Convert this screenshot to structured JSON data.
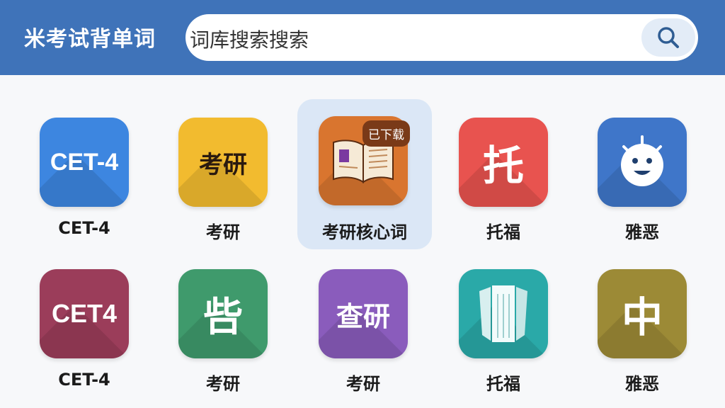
{
  "header": {
    "title": "米考试背单词",
    "search_value": "词库搜索搜索",
    "search_icon": "search-icon"
  },
  "colors": {
    "header_bg": "#3f73b9",
    "selected_bg": "#dbe7f6",
    "badge_bg": "#7a3a18"
  },
  "grid": {
    "row1": [
      {
        "label": "CET-4",
        "icon_text": "CET-4",
        "icon": "cet4-icon",
        "color": "#3d86e0"
      },
      {
        "label": "考研",
        "icon_text": "考研",
        "icon": "kaoyan-icon",
        "color": "#f2bb2f"
      },
      {
        "label": "考研核心词",
        "icon": "open-book-icon",
        "color": "#d9752f",
        "selected": true,
        "badge": "已下载"
      },
      {
        "label": "托福",
        "icon_text": "托",
        "icon": "toefl-icon",
        "color": "#e8534f"
      },
      {
        "label": "雅恶",
        "icon": "smiley-face-icon",
        "color": "#3f76c9"
      }
    ],
    "row2": [
      {
        "label": "CET-4",
        "icon_text": "CET4",
        "icon": "cet4-icon",
        "color": "#9b3d5a"
      },
      {
        "label": "考研",
        "icon_text": "呰",
        "icon": "kaoyan-icon",
        "color": "#3f9a6c"
      },
      {
        "label": "考研",
        "icon_text": "查研",
        "icon": "kaoyan-icon",
        "color": "#8a5cbc"
      },
      {
        "label": "托福",
        "icon": "building-icon",
        "color": "#2aa9a8"
      },
      {
        "label": "雅恶",
        "icon_text": "中",
        "icon": "ielts-icon",
        "color": "#9c8a36"
      }
    ]
  }
}
